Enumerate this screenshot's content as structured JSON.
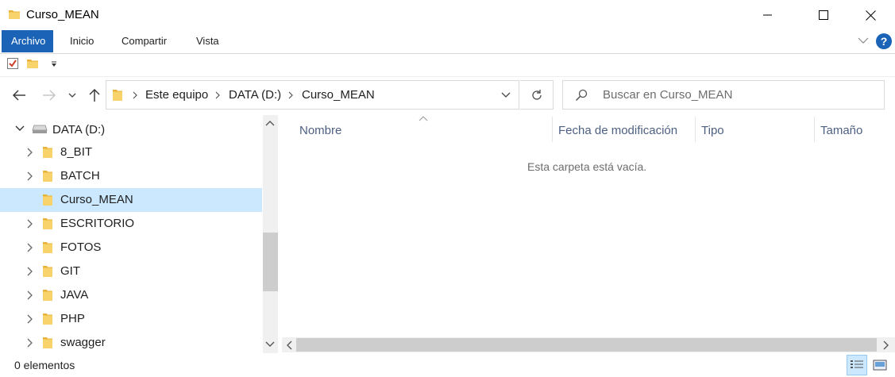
{
  "window": {
    "title": "Curso_MEAN",
    "icons": {
      "folder": "folder-icon",
      "minimize": "minimize-icon",
      "maximize": "maximize-icon",
      "close": "close-icon"
    }
  },
  "ribbon": {
    "tabs": [
      {
        "label": "Archivo"
      },
      {
        "label": "Inicio"
      },
      {
        "label": "Compartir"
      },
      {
        "label": "Vista"
      }
    ],
    "accent": "#1a63b6"
  },
  "quick_access": {
    "icons": [
      "properties-check-icon",
      "new-folder-icon",
      "customize-dropdown-icon"
    ]
  },
  "navigation": {
    "breadcrumbs": [
      "Este equipo",
      "DATA (D:)",
      "Curso_MEAN"
    ],
    "search_placeholder": "Buscar en Curso_MEAN"
  },
  "tree": {
    "drive_label": "DATA (D:)",
    "items": [
      {
        "label": "8_BIT",
        "expandable": true
      },
      {
        "label": "BATCH",
        "expandable": true
      },
      {
        "label": "Curso_MEAN",
        "expandable": false,
        "selected": true
      },
      {
        "label": "ESCRITORIO",
        "expandable": true
      },
      {
        "label": "FOTOS",
        "expandable": true
      },
      {
        "label": "GIT",
        "expandable": true
      },
      {
        "label": "JAVA",
        "expandable": true
      },
      {
        "label": "PHP",
        "expandable": true
      },
      {
        "label": "swagger",
        "expandable": true
      }
    ]
  },
  "content": {
    "columns": [
      {
        "label": "Nombre"
      },
      {
        "label": "Fecha de modificación"
      },
      {
        "label": "Tipo"
      },
      {
        "label": "Tamaño"
      }
    ],
    "empty_message": "Esta carpeta está vacía."
  },
  "status": {
    "item_count": "0 elementos"
  },
  "colors": {
    "selection": "#cce8ff",
    "folder": "#f8c94a",
    "help": "#1a63b6"
  }
}
